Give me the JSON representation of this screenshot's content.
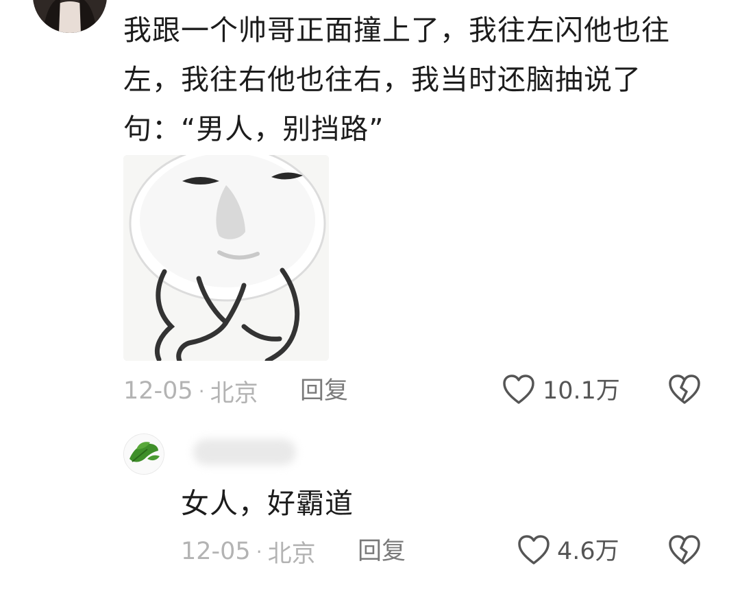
{
  "comment": {
    "text": "我跟一个帅哥正面撞上了，我往左闪他也往左，我往右他也往右，我当时还脑抽说了句：“男人，别挡路”",
    "date": "12-05",
    "separator": "·",
    "location": "北京",
    "reply_label": "回复",
    "like_count": "10.1万"
  },
  "reply": {
    "text": "女人，好霸道",
    "date": "12-05",
    "separator": "·",
    "location": "北京",
    "reply_label": "回复",
    "like_count": "4.6万"
  },
  "icons": {
    "like": "heart-outline-icon",
    "dislike": "broken-heart-icon"
  },
  "colors": {
    "text": "#1c1c1c",
    "meta": "#b3b3b3",
    "reply_action": "#7a7a7a",
    "icon": "#555555"
  }
}
